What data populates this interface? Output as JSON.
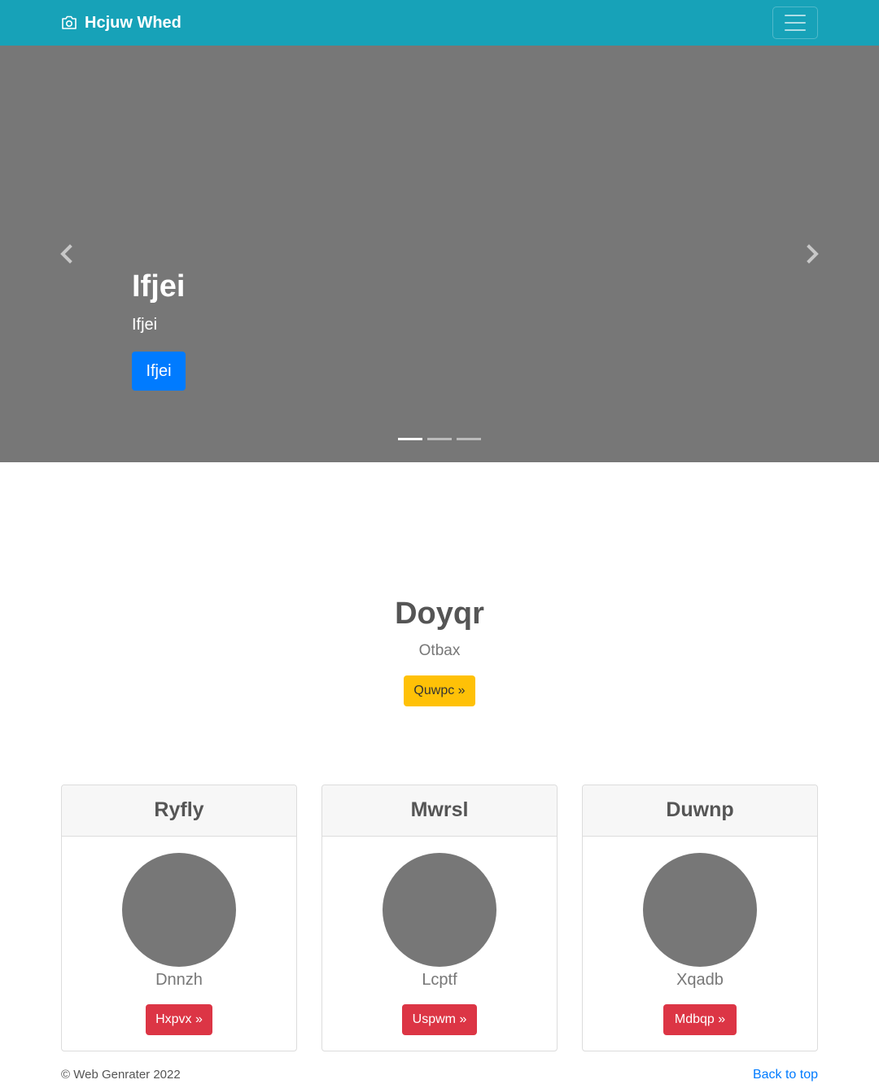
{
  "navbar": {
    "brand": "Hcjuw Whed",
    "brand_icon": "camera-icon",
    "toggler_icon": "hamburger-icon",
    "background": "#17a2b8"
  },
  "carousel": {
    "title": "Ifjei",
    "subtitle": "Ifjei",
    "button_label": "Ifjei",
    "prev_icon": "chevron-left-icon",
    "next_icon": "chevron-right-icon",
    "slide_count": 3,
    "active_slide": 1,
    "background": "#777777",
    "button_color": "#007bff"
  },
  "hero": {
    "title": "Doyqr",
    "subtitle": "Otbax",
    "button_label": "Quwpc »",
    "button_color": "#ffc107"
  },
  "cards": [
    {
      "header": "Ryfly",
      "name": "Dnnzh",
      "button_label": "Hxpvx »"
    },
    {
      "header": "Mwrsl",
      "name": "Lcptf",
      "button_label": "Uspwm »"
    },
    {
      "header": "Duwnp",
      "name": "Xqadb",
      "button_label": "Mdbqp »"
    }
  ],
  "card_button_color": "#dc3545",
  "footer": {
    "copyright": "© Web Genrater 2022",
    "back_to_top": "Back to top"
  }
}
